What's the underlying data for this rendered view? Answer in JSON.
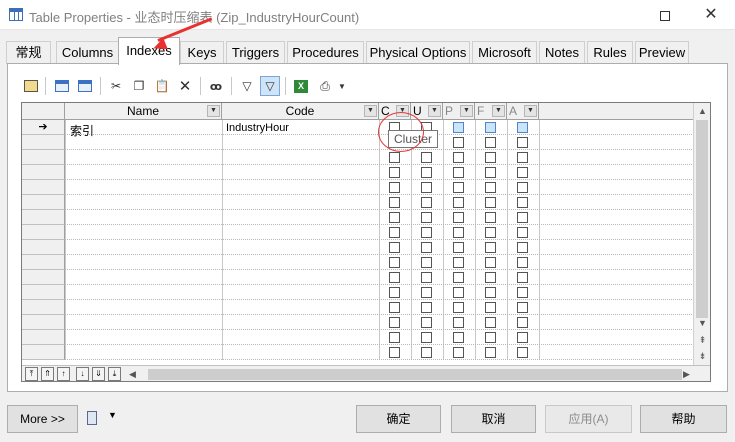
{
  "window": {
    "title": "Table Properties - 业态时压缩表 (Zip_IndustryHourCount)",
    "maximize": "",
    "close": "✕"
  },
  "tabs": [
    {
      "label": "常规"
    },
    {
      "label": "Columns"
    },
    {
      "label": "Indexes",
      "active": true
    },
    {
      "label": "Keys"
    },
    {
      "label": "Triggers"
    },
    {
      "label": "Procedures"
    },
    {
      "label": "Physical Options"
    },
    {
      "label": "Microsoft"
    },
    {
      "label": "Notes"
    },
    {
      "label": "Rules"
    },
    {
      "label": "Preview"
    }
  ],
  "grid": {
    "columns": [
      {
        "label": "Name"
      },
      {
        "label": "Code"
      },
      {
        "label": "C"
      },
      {
        "label": "U"
      },
      {
        "label": "P"
      },
      {
        "label": "F"
      },
      {
        "label": "A"
      }
    ],
    "current_row_marker": "➔",
    "rows": [
      {
        "name": "索引",
        "code": "IndustryHour"
      }
    ],
    "tooltip": "Cluster"
  },
  "footer": {
    "more": "More >>",
    "ok": "确定",
    "cancel": "取消",
    "apply": "应用(A)",
    "help": "帮助"
  }
}
